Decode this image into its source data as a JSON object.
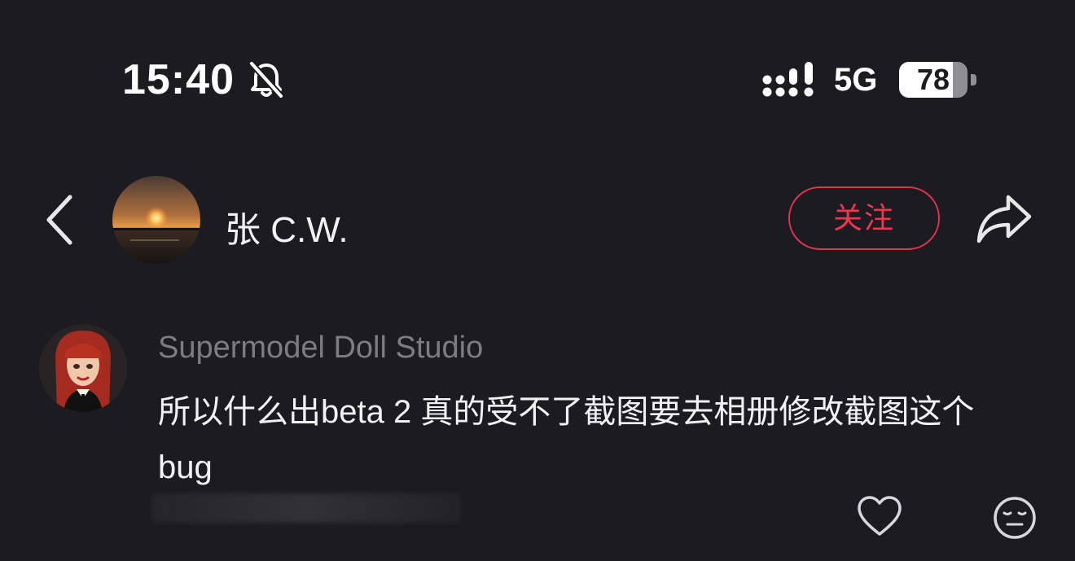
{
  "status_bar": {
    "time": "15:40",
    "network": "5G",
    "battery_level": "78",
    "battery_fraction": 0.78,
    "icons": [
      "bell-slash-icon",
      "signal-icon",
      "battery-icon"
    ]
  },
  "header": {
    "username": "张 C.W.",
    "follow_label": "关注",
    "icons": [
      "chevron-left-icon",
      "share-icon"
    ]
  },
  "comment": {
    "author": "Supermodel Doll Studio",
    "text": "所以什么出beta 2 真的受不了截图要去相册修改截图这个 bug",
    "icons": [
      "heart-icon",
      "emoji-reaction-icon"
    ]
  },
  "colors": {
    "background": "#1c1b21",
    "accent_red": "#f0364e",
    "secondary_text": "#7d7b83",
    "primary_text": "#f2f2f2"
  }
}
